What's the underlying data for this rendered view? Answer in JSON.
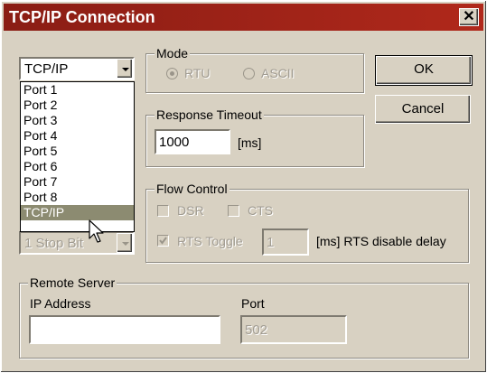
{
  "window": {
    "title": "TCP/IP Connection",
    "close_glyph": "✕"
  },
  "port_select": {
    "value": "TCP/IP",
    "options": [
      "Port 1",
      "Port 2",
      "Port 3",
      "Port 4",
      "Port 5",
      "Port 6",
      "Port 7",
      "Port 8",
      "TCP/IP"
    ],
    "selected_index": 8
  },
  "stop_bit_select": {
    "value": "1 Stop Bit"
  },
  "mode": {
    "label": "Mode",
    "rtu": "RTU",
    "ascii": "ASCII",
    "selected": "RTU"
  },
  "response_timeout": {
    "label": "Response Timeout",
    "value": "1000",
    "unit": "[ms]"
  },
  "flow_control": {
    "label": "Flow Control",
    "dsr": "DSR",
    "cts": "CTS",
    "rts_toggle": "RTS Toggle",
    "rts_value": "1",
    "rts_suffix": "[ms] RTS disable delay"
  },
  "remote_server": {
    "label": "Remote Server",
    "ip_label": "IP Address",
    "ip_value": "",
    "port_label": "Port",
    "port_value": "502"
  },
  "buttons": {
    "ok": "OK",
    "cancel": "Cancel"
  },
  "icons": {
    "cursor": "arrow-cursor-icon",
    "dropdown": "chevron-down-icon"
  },
  "colors": {
    "titlebar": "#8a1d14",
    "face": "#d8d1c2",
    "selection": "#8c8b71"
  }
}
